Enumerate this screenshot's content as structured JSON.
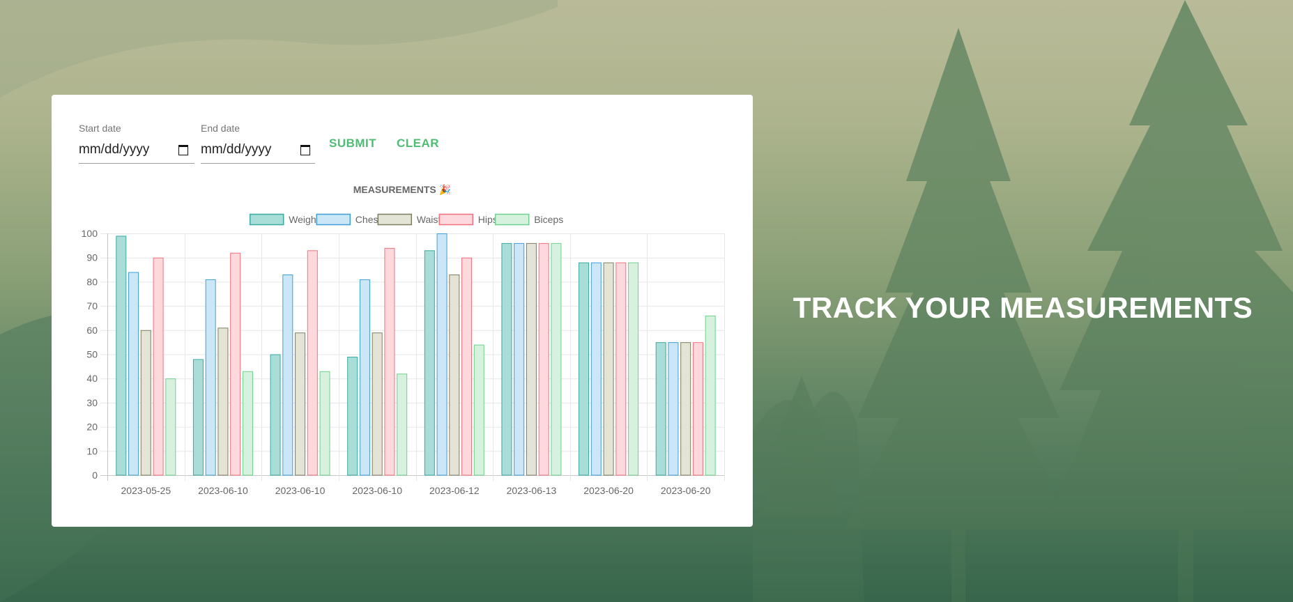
{
  "filters": {
    "start_label": "Start date",
    "start_value": "mm/dd/yyyy",
    "end_label": "End date",
    "end_value": "mm/dd/yyyy",
    "submit_label": "SUBMIT",
    "clear_label": "CLEAR",
    "calendar_icon": "calendar-icon"
  },
  "hero": {
    "title": "TRACK YOUR MEASUREMENTS"
  },
  "colors": {
    "accent": "#4dbd74"
  },
  "chart_data": {
    "type": "bar",
    "title": "MEASUREMENTS",
    "title_emoji": "🎉",
    "categories": [
      "2023-05-25",
      "2023-06-10",
      "2023-06-10",
      "2023-06-10",
      "2023-06-12",
      "2023-06-13",
      "2023-06-20",
      "2023-06-20"
    ],
    "ylim": [
      0,
      100
    ],
    "yticks": [
      0,
      10,
      20,
      30,
      40,
      50,
      60,
      70,
      80,
      90,
      100
    ],
    "grid": true,
    "legend_position": "top",
    "series": [
      {
        "name": "Weight",
        "values": [
          99,
          48,
          50,
          49,
          93,
          96,
          88,
          55
        ],
        "fill": "#a8ddd8",
        "stroke": "#3aa9a0"
      },
      {
        "name": "Chest",
        "values": [
          84,
          81,
          83,
          81,
          100,
          96,
          88,
          55
        ],
        "fill": "#cbe6f7",
        "stroke": "#3f9ed6"
      },
      {
        "name": "Waist",
        "values": [
          60,
          61,
          59,
          59,
          83,
          96,
          88,
          55
        ],
        "fill": "#e3e3d6",
        "stroke": "#7d7d62"
      },
      {
        "name": "Hips",
        "values": [
          90,
          92,
          93,
          94,
          90,
          96,
          88,
          55
        ],
        "fill": "#fdd9dd",
        "stroke": "#f2707d"
      },
      {
        "name": "Biceps",
        "values": [
          40,
          43,
          43,
          42,
          54,
          96,
          88,
          66
        ],
        "fill": "#d6f2de",
        "stroke": "#6fcf8c"
      }
    ]
  }
}
